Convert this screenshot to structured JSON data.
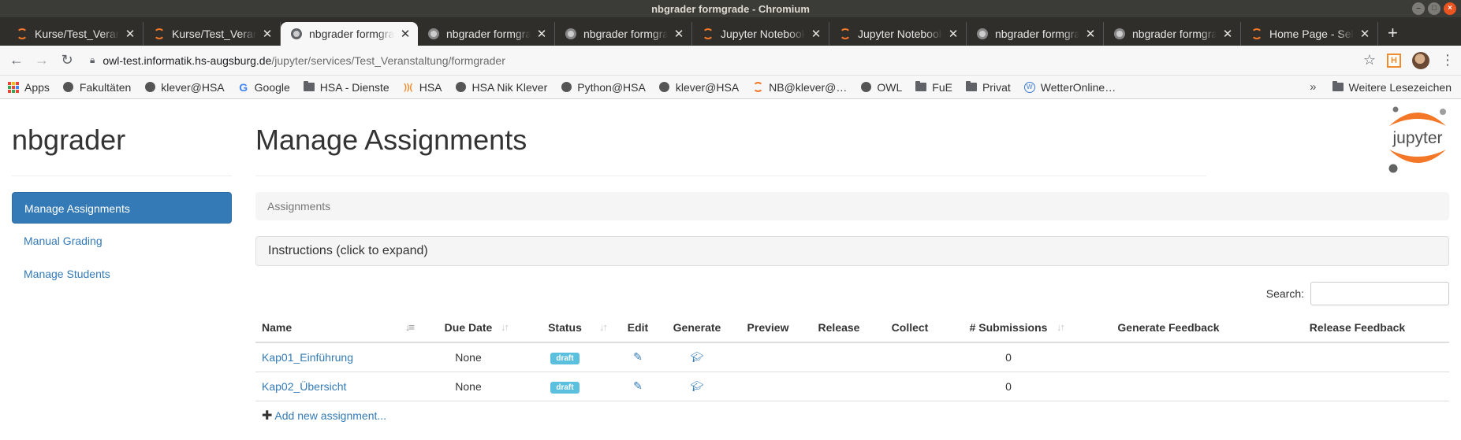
{
  "window": {
    "title": "nbgrader formgrade - Chromium"
  },
  "tabs": [
    {
      "title": "Kurse/Test_Veranstaltung",
      "favicon": "jupyter-icon",
      "active": false
    },
    {
      "title": "Kurse/Test_Veranstaltung",
      "favicon": "jupyter-icon",
      "active": false
    },
    {
      "title": "nbgrader formgrade",
      "favicon": "globe-icon",
      "active": true
    },
    {
      "title": "nbgrader formgrade",
      "favicon": "globe-icon",
      "active": false
    },
    {
      "title": "nbgrader formgrade",
      "favicon": "globe-icon",
      "active": false
    },
    {
      "title": "Jupyter Notebook",
      "favicon": "jupyter-icon",
      "active": false
    },
    {
      "title": "Jupyter Notebook",
      "favicon": "jupyter-icon",
      "active": false
    },
    {
      "title": "nbgrader formgrade",
      "favicon": "globe-icon",
      "active": false
    },
    {
      "title": "nbgrader formgrade",
      "favicon": "globe-icon",
      "active": false
    },
    {
      "title": "Home Page - Select or create a notebook",
      "favicon": "jupyter-icon",
      "active": false
    }
  ],
  "address": {
    "host": "owl-test.informatik.hs-augsburg.de",
    "path": "/jupyter/services/Test_Veranstaltung/formgrader"
  },
  "bookmarks": [
    {
      "label": "Apps",
      "icon": "apps-icon"
    },
    {
      "label": "Fakultäten",
      "icon": "globe-icon"
    },
    {
      "label": "klever@HSA",
      "icon": "globe-icon"
    },
    {
      "label": "Google",
      "icon": "google-icon"
    },
    {
      "label": "HSA - Dienste",
      "icon": "folder-icon"
    },
    {
      "label": "HSA",
      "icon": "hsa-icon"
    },
    {
      "label": "HSA Nik Klever",
      "icon": "globe-icon"
    },
    {
      "label": "Python@HSA",
      "icon": "globe-icon"
    },
    {
      "label": "klever@HSA",
      "icon": "globe-icon"
    },
    {
      "label": "NB@klever@…",
      "icon": "jupyter-icon"
    },
    {
      "label": "OWL",
      "icon": "globe-icon"
    },
    {
      "label": "FuE",
      "icon": "folder-icon"
    },
    {
      "label": "Privat",
      "icon": "folder-icon"
    },
    {
      "label": "WetterOnline…",
      "icon": "wetter-icon"
    }
  ],
  "bookmarks_overflow": "»",
  "bookmarks_other": "Weitere Lesezeichen",
  "sidebar": {
    "brand": "nbgrader",
    "items": [
      {
        "label": "Manage Assignments",
        "active": true
      },
      {
        "label": "Manual Grading",
        "active": false
      },
      {
        "label": "Manage Students",
        "active": false
      }
    ]
  },
  "main": {
    "title": "Manage Assignments",
    "logo_text": "jupyter",
    "breadcrumb": "Assignments",
    "instructions": "Instructions (click to expand)",
    "search_label": "Search:",
    "search_value": "",
    "columns": [
      "Name",
      "Due Date",
      "Status",
      "Edit",
      "Generate",
      "Preview",
      "Release",
      "Collect",
      "# Submissions",
      "Generate Feedback",
      "Release Feedback"
    ],
    "rows": [
      {
        "name": "Kap01_Einführung",
        "due": "None",
        "status": "draft",
        "submissions": "0"
      },
      {
        "name": "Kap02_Übersicht",
        "due": "None",
        "status": "draft",
        "submissions": "0"
      }
    ],
    "add_label": "Add new assignment..."
  },
  "colors": {
    "link": "#337ab7",
    "badge": "#5bc0de",
    "tab_bar": "#2f2e2b",
    "jupyter_orange": "#f37726"
  }
}
